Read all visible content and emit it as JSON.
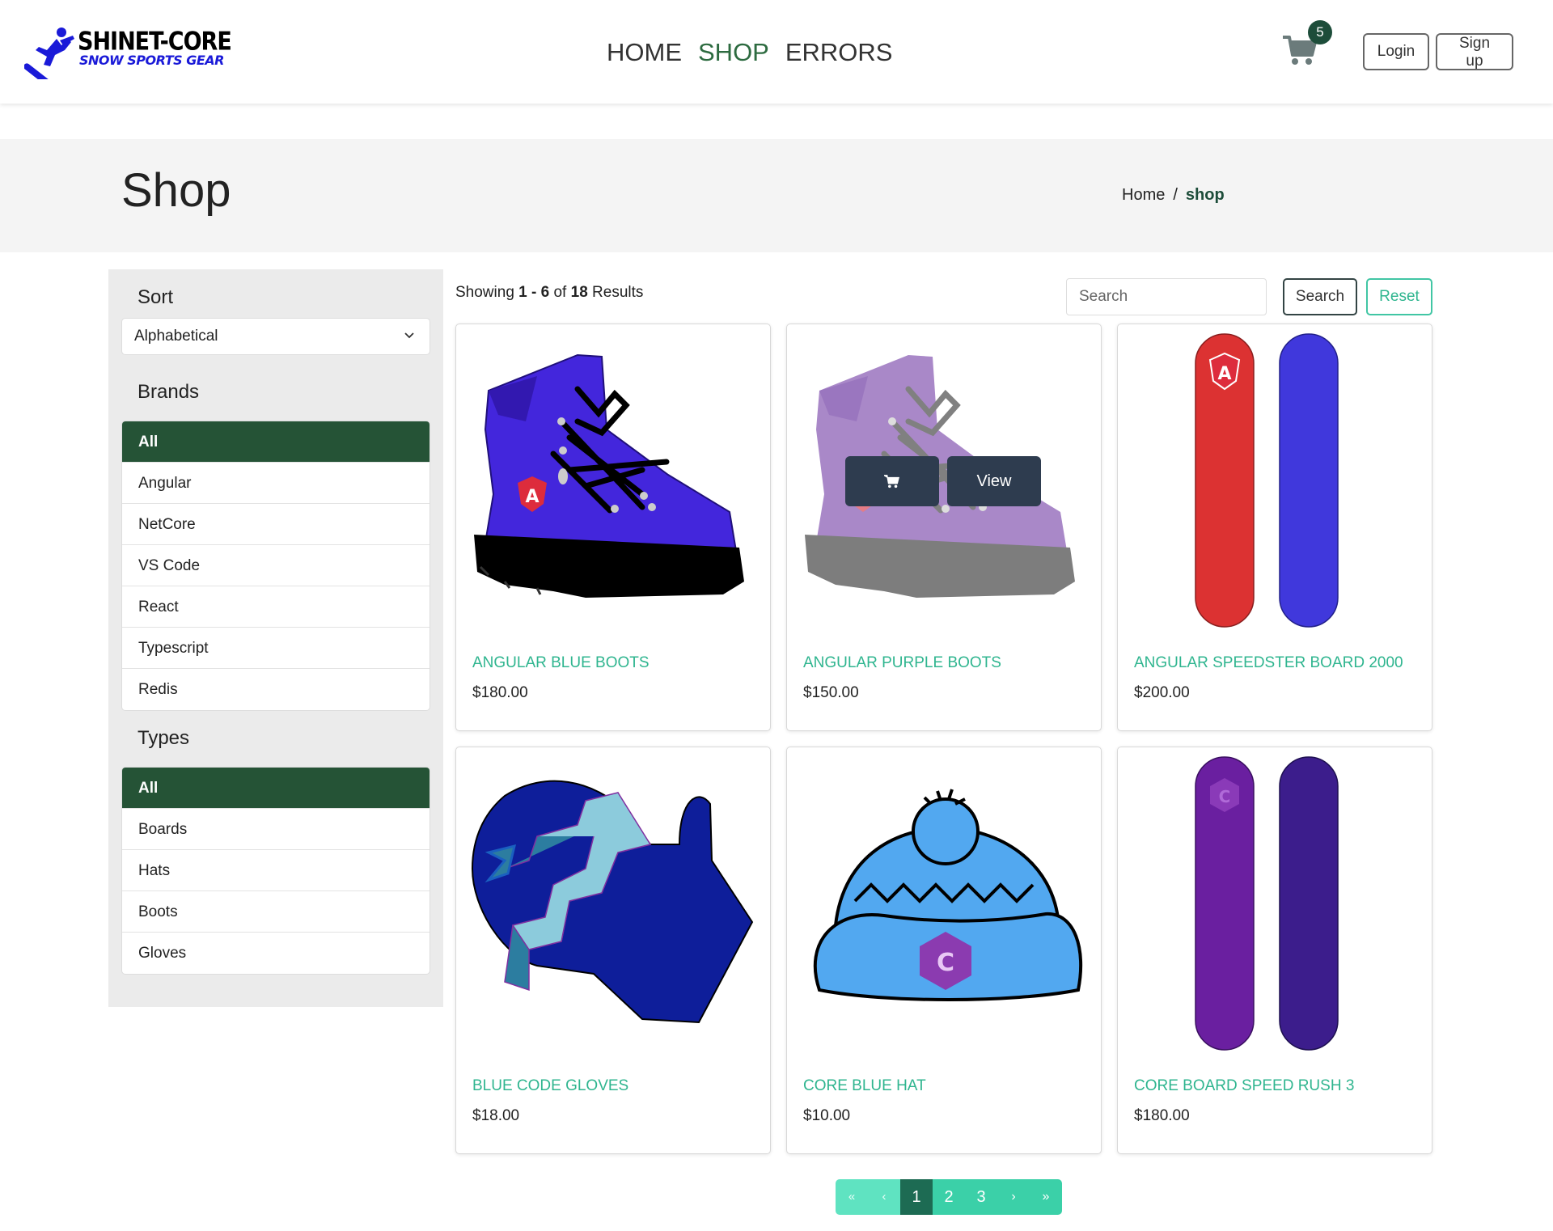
{
  "brand": {
    "name": "SHINET-CORE",
    "tagline": "SNOW SPORTS GEAR"
  },
  "nav": {
    "links": [
      "HOME",
      "SHOP",
      "ERRORS"
    ],
    "active": "SHOP",
    "cart_count": "5",
    "login_label": "Login",
    "signup_label": "Sign up"
  },
  "header": {
    "title": "Shop",
    "breadcrumb_home": "Home",
    "breadcrumb_sep": "/",
    "breadcrumb_current": "shop"
  },
  "sidebar": {
    "sort_heading": "Sort",
    "sort_value": "Alphabetical",
    "brands_heading": "Brands",
    "brands": [
      "All",
      "Angular",
      "NetCore",
      "VS Code",
      "React",
      "Typescript",
      "Redis"
    ],
    "brands_selected": "All",
    "types_heading": "Types",
    "types": [
      "All",
      "Boards",
      "Hats",
      "Boots",
      "Gloves"
    ],
    "types_selected": "All"
  },
  "results": {
    "prefix": "Showing",
    "range": "1 - 6",
    "of": "of",
    "total": "18",
    "suffix": "Results"
  },
  "search": {
    "placeholder": "Search",
    "search_label": "Search",
    "reset_label": "Reset"
  },
  "products": [
    {
      "name": "ANGULAR BLUE BOOTS",
      "price": "$180.00",
      "image": "boot-blue"
    },
    {
      "name": "ANGULAR PURPLE BOOTS",
      "price": "$150.00",
      "image": "boot-purple"
    },
    {
      "name": "ANGULAR SPEEDSTER BOARD 2000",
      "price": "$200.00",
      "image": "board-red-blue"
    },
    {
      "name": "BLUE CODE GLOVES",
      "price": "$18.00",
      "image": "glove-blue"
    },
    {
      "name": "CORE BLUE HAT",
      "price": "$10.00",
      "image": "hat-blue"
    },
    {
      "name": "CORE BOARD SPEED RUSH 3",
      "price": "$180.00",
      "image": "board-purple"
    }
  ],
  "hover_overlay": {
    "view_label": "View",
    "cart_icon": "cart-icon"
  },
  "pagination": {
    "first": "«",
    "prev": "‹",
    "pages": [
      "1",
      "2",
      "3"
    ],
    "current": "1",
    "next": "›",
    "last": "»"
  },
  "colors": {
    "accent_green": "#255336",
    "teal": "#2fb58f",
    "pagination_teal": "#3bd0a8"
  }
}
